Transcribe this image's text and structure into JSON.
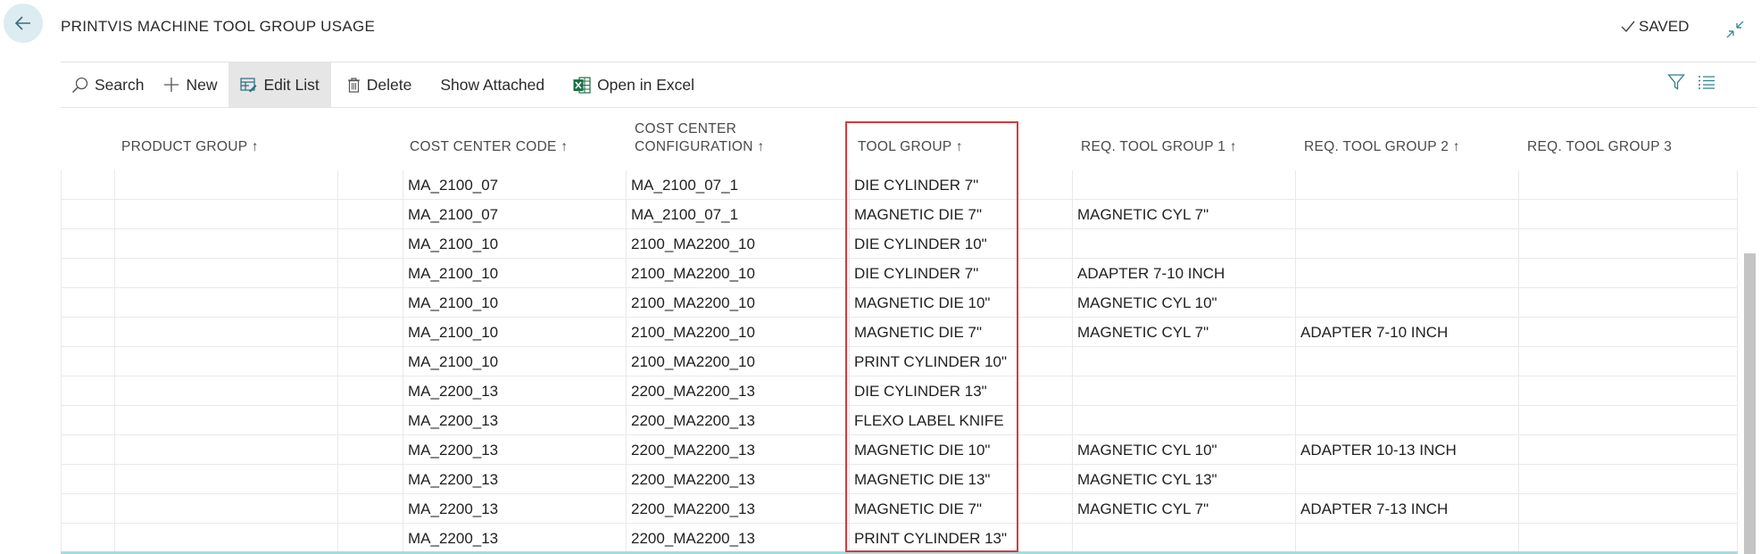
{
  "header": {
    "title": "PRINTVIS MACHINE TOOL GROUP USAGE",
    "status": "SAVED"
  },
  "toolbar": {
    "search": "Search",
    "new": "New",
    "edit_list": "Edit List",
    "delete": "Delete",
    "show_attached": "Show Attached",
    "open_in_excel": "Open in Excel"
  },
  "columns": {
    "product_group": "PRODUCT GROUP ↑",
    "cost_center_code": "COST CENTER CODE ↑",
    "cost_center_configuration_line1": "COST CENTER",
    "cost_center_configuration_line2": "CONFIGURATION ↑",
    "tool_group": "TOOL GROUP ↑",
    "req_tool_group_1": "REQ. TOOL GROUP 1 ↑",
    "req_tool_group_2": "REQ. TOOL GROUP 2 ↑",
    "req_tool_group_3": "REQ. TOOL GROUP 3"
  },
  "rows": [
    {
      "cost_center_code": "MA_2100_07",
      "configuration": "MA_2100_07_1",
      "tool_group": "DIE CYLINDER 7\"",
      "req1": "",
      "req2": "",
      "req3": ""
    },
    {
      "cost_center_code": "MA_2100_07",
      "configuration": "MA_2100_07_1",
      "tool_group": "MAGNETIC DIE 7\"",
      "req1": "MAGNETIC CYL 7\"",
      "req2": "",
      "req3": ""
    },
    {
      "cost_center_code": "MA_2100_10",
      "configuration": "2100_MA2200_10",
      "tool_group": "DIE CYLINDER 10\"",
      "req1": "",
      "req2": "",
      "req3": ""
    },
    {
      "cost_center_code": "MA_2100_10",
      "configuration": "2100_MA2200_10",
      "tool_group": "DIE CYLINDER 7\"",
      "req1": "ADAPTER 7-10 INCH",
      "req2": "",
      "req3": ""
    },
    {
      "cost_center_code": "MA_2100_10",
      "configuration": "2100_MA2200_10",
      "tool_group": "MAGNETIC DIE 10\"",
      "req1": "MAGNETIC CYL 10\"",
      "req2": "",
      "req3": ""
    },
    {
      "cost_center_code": "MA_2100_10",
      "configuration": "2100_MA2200_10",
      "tool_group": "MAGNETIC DIE 7\"",
      "req1": "MAGNETIC CYL 7\"",
      "req2": "ADAPTER 7-10 INCH",
      "req3": ""
    },
    {
      "cost_center_code": "MA_2100_10",
      "configuration": "2100_MA2200_10",
      "tool_group": "PRINT CYLINDER 10\"",
      "req1": "",
      "req2": "",
      "req3": ""
    },
    {
      "cost_center_code": "MA_2200_13",
      "configuration": "2200_MA2200_13",
      "tool_group": "DIE CYLINDER 13\"",
      "req1": "",
      "req2": "",
      "req3": ""
    },
    {
      "cost_center_code": "MA_2200_13",
      "configuration": "2200_MA2200_13",
      "tool_group": "FLEXO LABEL KNIFE",
      "req1": "",
      "req2": "",
      "req3": ""
    },
    {
      "cost_center_code": "MA_2200_13",
      "configuration": "2200_MA2200_13",
      "tool_group": "MAGNETIC DIE 10\"",
      "req1": "MAGNETIC CYL 10\"",
      "req2": "ADAPTER 10-13 INCH",
      "req3": ""
    },
    {
      "cost_center_code": "MA_2200_13",
      "configuration": "2200_MA2200_13",
      "tool_group": "MAGNETIC DIE 13\"",
      "req1": "MAGNETIC CYL 13\"",
      "req2": "",
      "req3": ""
    },
    {
      "cost_center_code": "MA_2200_13",
      "configuration": "2200_MA2200_13",
      "tool_group": "MAGNETIC DIE 7\"",
      "req1": "MAGNETIC CYL 7\"",
      "req2": "ADAPTER 7-13 INCH",
      "req3": ""
    },
    {
      "cost_center_code": "MA_2200_13",
      "configuration": "2200_MA2200_13",
      "tool_group": "PRINT CYLINDER 13\"",
      "req1": "",
      "req2": "",
      "req3": ""
    }
  ],
  "colors": {
    "accent": "#0f6e80",
    "highlight_border": "#d9383e",
    "selected_row_band": "#a8dbe2",
    "excel_green": "#1d7044"
  }
}
